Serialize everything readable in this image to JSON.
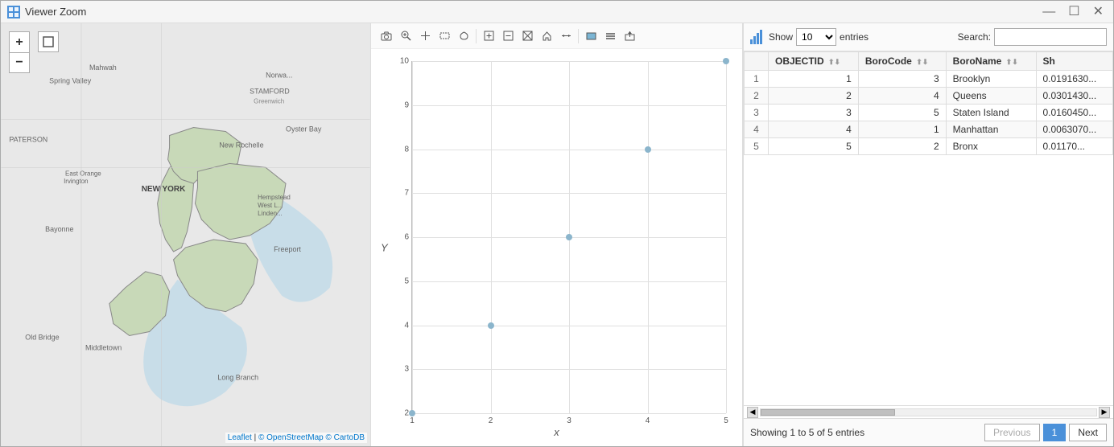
{
  "window": {
    "title": "Viewer Zoom",
    "icon": "V"
  },
  "titlebar": {
    "minimize": "—",
    "maximize": "☐",
    "close": "✕"
  },
  "map": {
    "zoom_in": "+",
    "zoom_out": "−",
    "expand_icon": "⤢",
    "attribution_leaflet": "Leaflet",
    "attribution_osm": "© OpenStreetMap",
    "attribution_cartodb": "© CartoDB"
  },
  "chart": {
    "x_label": "x",
    "y_label": "Y",
    "x_ticks": [
      1,
      2,
      3,
      4,
      5
    ],
    "y_ticks": [
      2,
      3,
      4,
      5,
      6,
      7,
      8,
      9,
      10
    ],
    "data_points": [
      {
        "x": 1,
        "y": 2
      },
      {
        "x": 2,
        "y": 4
      },
      {
        "x": 3,
        "y": 6
      },
      {
        "x": 4,
        "y": 8
      },
      {
        "x": 5,
        "y": 10
      }
    ],
    "toolbar_buttons": [
      {
        "name": "camera",
        "icon": "📷"
      },
      {
        "name": "zoom-area",
        "icon": "🔍"
      },
      {
        "name": "pan",
        "icon": "+"
      },
      {
        "name": "select-rect",
        "icon": "▭"
      },
      {
        "name": "lasso",
        "icon": "○"
      },
      {
        "name": "add-point",
        "icon": "⊞"
      },
      {
        "name": "remove-point",
        "icon": "⊟"
      },
      {
        "name": "reset",
        "icon": "⊠"
      },
      {
        "name": "home",
        "icon": "⌂"
      },
      {
        "name": "arrows",
        "icon": "↔"
      },
      {
        "name": "rect-select",
        "icon": "▬"
      },
      {
        "name": "line-select",
        "icon": "≡"
      },
      {
        "name": "export",
        "icon": "⇧"
      }
    ]
  },
  "table": {
    "show_label": "Show",
    "entries_value": "10",
    "entries_label": "entries",
    "search_label": "Search:",
    "search_placeholder": "",
    "columns": [
      {
        "id": "row",
        "label": ""
      },
      {
        "id": "objectid",
        "label": "OBJECTID",
        "sortable": true
      },
      {
        "id": "borocode",
        "label": "BoroCode",
        "sortable": true
      },
      {
        "id": "boroname",
        "label": "BoroName",
        "sortable": true
      },
      {
        "id": "shape",
        "label": "Sh",
        "sortable": false
      }
    ],
    "rows": [
      {
        "row": 1,
        "objectid": 1,
        "borocode": 3,
        "boroname": "Brooklyn",
        "shape": "0.0191630..."
      },
      {
        "row": 2,
        "objectid": 2,
        "borocode": 4,
        "boroname": "Queens",
        "shape": "0.0301430..."
      },
      {
        "row": 3,
        "objectid": 3,
        "borocode": 5,
        "boroname": "Staten Island",
        "shape": "0.0160450..."
      },
      {
        "row": 4,
        "objectid": 4,
        "borocode": 1,
        "boroname": "Manhattan",
        "shape": "0.0063070..."
      },
      {
        "row": 5,
        "objectid": 5,
        "borocode": 2,
        "boroname": "Bronx",
        "shape": "0.01170..."
      }
    ],
    "footer": {
      "showing_text": "Showing 1 to 5 of 5 entries",
      "prev_label": "Previous",
      "next_label": "Next",
      "current_page": "1"
    }
  }
}
